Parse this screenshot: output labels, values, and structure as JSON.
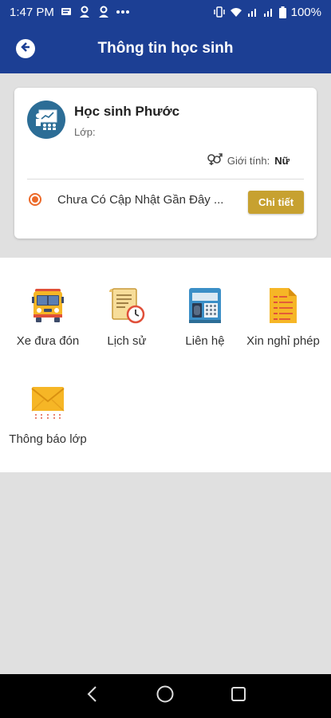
{
  "status_bar": {
    "time": "1:47 PM",
    "battery": "100%"
  },
  "header": {
    "title": "Thông tin học sinh"
  },
  "student_card": {
    "name": "Học sinh Phước",
    "class_label": "Lớp:",
    "gender_label": "Giới tính:",
    "gender_value": "Nữ",
    "update_text": "Chưa Có Cập Nhật Gần Đây ...",
    "detail_button": "Chi tiết"
  },
  "menu": {
    "items": [
      {
        "label": "Xe đưa đón",
        "icon": "school-bus-icon"
      },
      {
        "label": "Lịch sử",
        "icon": "history-document-icon"
      },
      {
        "label": "Liên hệ",
        "icon": "contact-phone-icon"
      },
      {
        "label": "Xin nghỉ phép",
        "icon": "leave-request-document-icon"
      },
      {
        "label": "Thông báo lớp",
        "icon": "envelope-icon"
      }
    ]
  },
  "colors": {
    "primary": "#1c3f94",
    "accent_button": "#c7a130",
    "radio": "#ec6a2a",
    "background": "#e0e0e0"
  }
}
